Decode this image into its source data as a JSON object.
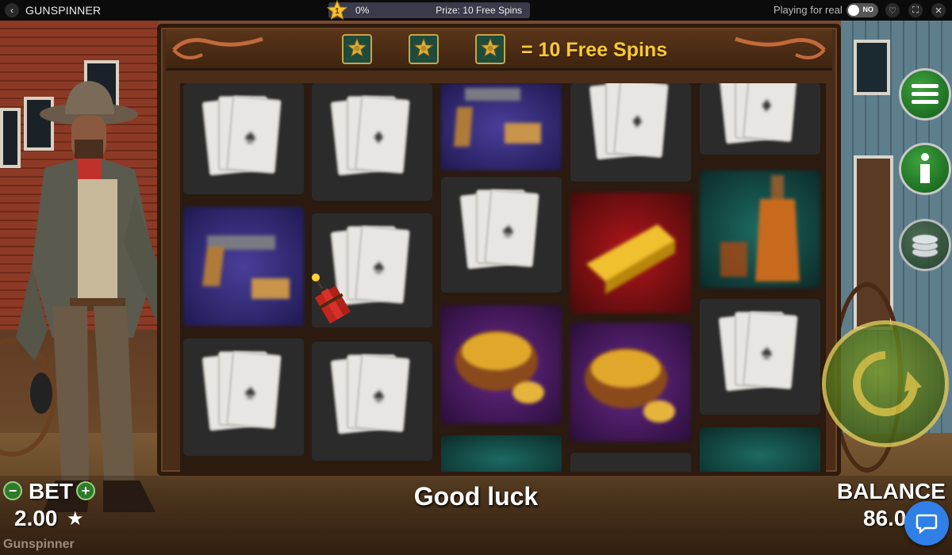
{
  "topbar": {
    "title": "GUNSPINNER",
    "level": "1",
    "progress_percent": "0%",
    "progress_value": 0,
    "prize": "Prize: 10 Free Spins",
    "playing_for_real": "Playing for real",
    "toggle_label": "NO"
  },
  "banner": {
    "free_spins_text": "= 10 Free Spins",
    "sheriff_badge_count": 3
  },
  "reels": [
    [
      "card-spade",
      "gun",
      "card-spade"
    ],
    [
      "card-diamond",
      "card-spade",
      "card-spade"
    ],
    [
      "gun",
      "card-spade",
      "nugget",
      "whisky"
    ],
    [
      "card-diamond",
      "gold-bar",
      "nugget",
      "card"
    ],
    [
      "card-diamond",
      "whisky",
      "card-spade",
      "whisky"
    ]
  ],
  "hud": {
    "bet_label": "BET",
    "bet_value": "2.00",
    "status_message": "Good luck",
    "balance_label": "BALANCE",
    "balance_value": "86.0",
    "game_name": "Gunspinner"
  },
  "icons": {
    "back": "chevron-left-icon",
    "heart": "heart-icon",
    "fullscreen": "fullscreen-icon",
    "close": "close-icon",
    "menu": "hamburger-icon",
    "info": "info-icon",
    "coins": "coins-icon",
    "spin": "spin-arrows-icon",
    "chat": "chat-icon"
  },
  "colors": {
    "accent_gold": "#f7c934",
    "button_green": "#2e7a2a",
    "chat_blue": "#2f7fe6"
  }
}
